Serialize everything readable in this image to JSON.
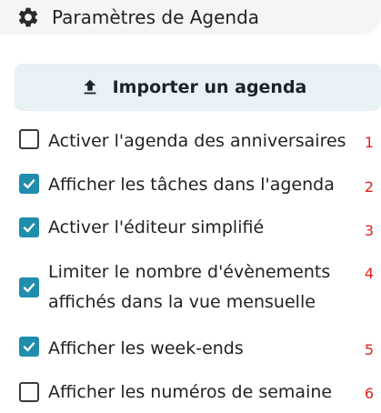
{
  "header": {
    "icon": "gear-icon",
    "title": "Paramètres de Agenda"
  },
  "import_button": {
    "icon": "upload-icon",
    "label": "Importer un agenda"
  },
  "options": [
    {
      "label_lines": [
        "Activer l'agenda des anniversaires"
      ],
      "checked": false,
      "marker": "1"
    },
    {
      "label_lines": [
        "Afficher les tâches dans l'agenda"
      ],
      "checked": true,
      "marker": "2"
    },
    {
      "label_lines": [
        "Activer l'éditeur simplifié"
      ],
      "checked": true,
      "marker": "3"
    },
    {
      "label_lines": [
        "Limiter le nombre d'évènements",
        "affichés dans la vue mensuelle"
      ],
      "checked": true,
      "marker": "4"
    },
    {
      "label_lines": [
        "Afficher les week-ends"
      ],
      "checked": true,
      "marker": "5"
    },
    {
      "label_lines": [
        "Afficher les numéros de semaine"
      ],
      "checked": false,
      "marker": "6"
    }
  ],
  "colors": {
    "accent": "#1f8dab",
    "marker": "#e02020",
    "button_bg": "#e8f1f5"
  }
}
